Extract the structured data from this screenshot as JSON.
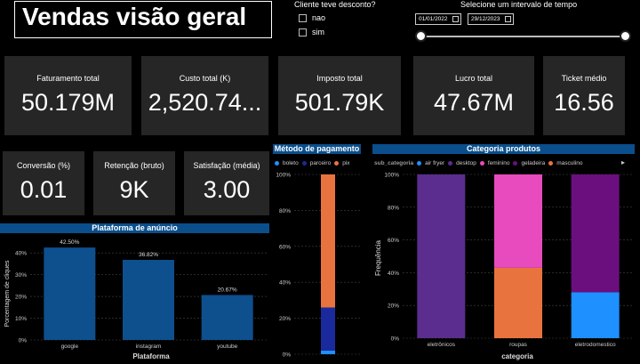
{
  "header": {
    "title": "Vendas visão geral"
  },
  "discount_filter": {
    "title": "Cliente teve desconto?",
    "options": [
      "nao",
      "sim"
    ]
  },
  "date_filter": {
    "title": "Selecione um intervalo de tempo",
    "start": "01/01/2022",
    "end": "29/12/2023"
  },
  "kpis": {
    "faturamento": {
      "label": "Faturamento total",
      "value": "50.179M"
    },
    "custo": {
      "label": "Custo total (K)",
      "value": "2,520.74..."
    },
    "imposto": {
      "label": "Imposto total",
      "value": "501.79K"
    },
    "lucro": {
      "label": "Lucro total",
      "value": "47.67M"
    },
    "ticket": {
      "label": "Ticket médio",
      "value": "16.56"
    },
    "conversao": {
      "label": "Conversão (%)",
      "value": "0.01"
    },
    "retencao": {
      "label": "Retenção (bruto)",
      "value": "9K"
    },
    "satisfacao": {
      "label": "Satisfação (média)",
      "value": "3.00"
    }
  },
  "colors": {
    "header_blue": "#0a4f8c",
    "bar_blue": "#0e4f8e",
    "boleto": "#1e90ff",
    "parceiro": "#1a2a9c",
    "pix": "#e9733f",
    "desktop": "#5b2d8e",
    "feminino": "#e84bbd",
    "geladeira": "#6b0f7e",
    "masculino": "#e9733f"
  },
  "chart_data": [
    {
      "type": "bar",
      "title": "Plataforma de anúncio",
      "xlabel": "Plataforma",
      "ylabel": "Porcentagem de cliques",
      "categories": [
        "google",
        "instagram",
        "youtube"
      ],
      "values": [
        42.5,
        36.82,
        20.67
      ],
      "data_labels": [
        "42.50%",
        "36.82%",
        "20.67%"
      ],
      "yticks": [
        "0%",
        "10%",
        "20%",
        "30%",
        "40%"
      ],
      "ylim": [
        0,
        45
      ],
      "grid": true
    },
    {
      "type": "bar",
      "stacked": true,
      "title": "Método de pagamento",
      "legend": [
        "boleto",
        "parceiro",
        "pix"
      ],
      "series": [
        {
          "name": "boleto",
          "values": [
            2
          ]
        },
        {
          "name": "parceiro",
          "values": [
            24
          ]
        },
        {
          "name": "pix",
          "values": [
            74
          ]
        }
      ],
      "yticks": [
        "0%",
        "20%",
        "40%",
        "60%",
        "80%",
        "100%"
      ],
      "ylim": [
        0,
        100
      ],
      "grid": true
    },
    {
      "type": "bar",
      "stacked": true,
      "title": "Categoria produtos",
      "legend_title": "sub_categoria",
      "legend": [
        "air fryer",
        "desktop",
        "feminino",
        "geladeira",
        "masculino"
      ],
      "categories": [
        "eletrônicos",
        "roupas",
        "eletrodomestico"
      ],
      "series": [
        {
          "name": "air fryer",
          "values": [
            0,
            0,
            28
          ]
        },
        {
          "name": "desktop",
          "values": [
            100,
            0,
            0
          ]
        },
        {
          "name": "feminino",
          "values": [
            0,
            57,
            0
          ]
        },
        {
          "name": "geladeira",
          "values": [
            0,
            0,
            72
          ]
        },
        {
          "name": "masculino",
          "values": [
            0,
            43,
            0
          ]
        }
      ],
      "xlabel": "categoria",
      "ylabel": "Frequência",
      "yticks": [
        "0%",
        "20%",
        "40%",
        "60%",
        "80%",
        "100%"
      ],
      "ylim": [
        0,
        100
      ],
      "grid": true
    }
  ]
}
